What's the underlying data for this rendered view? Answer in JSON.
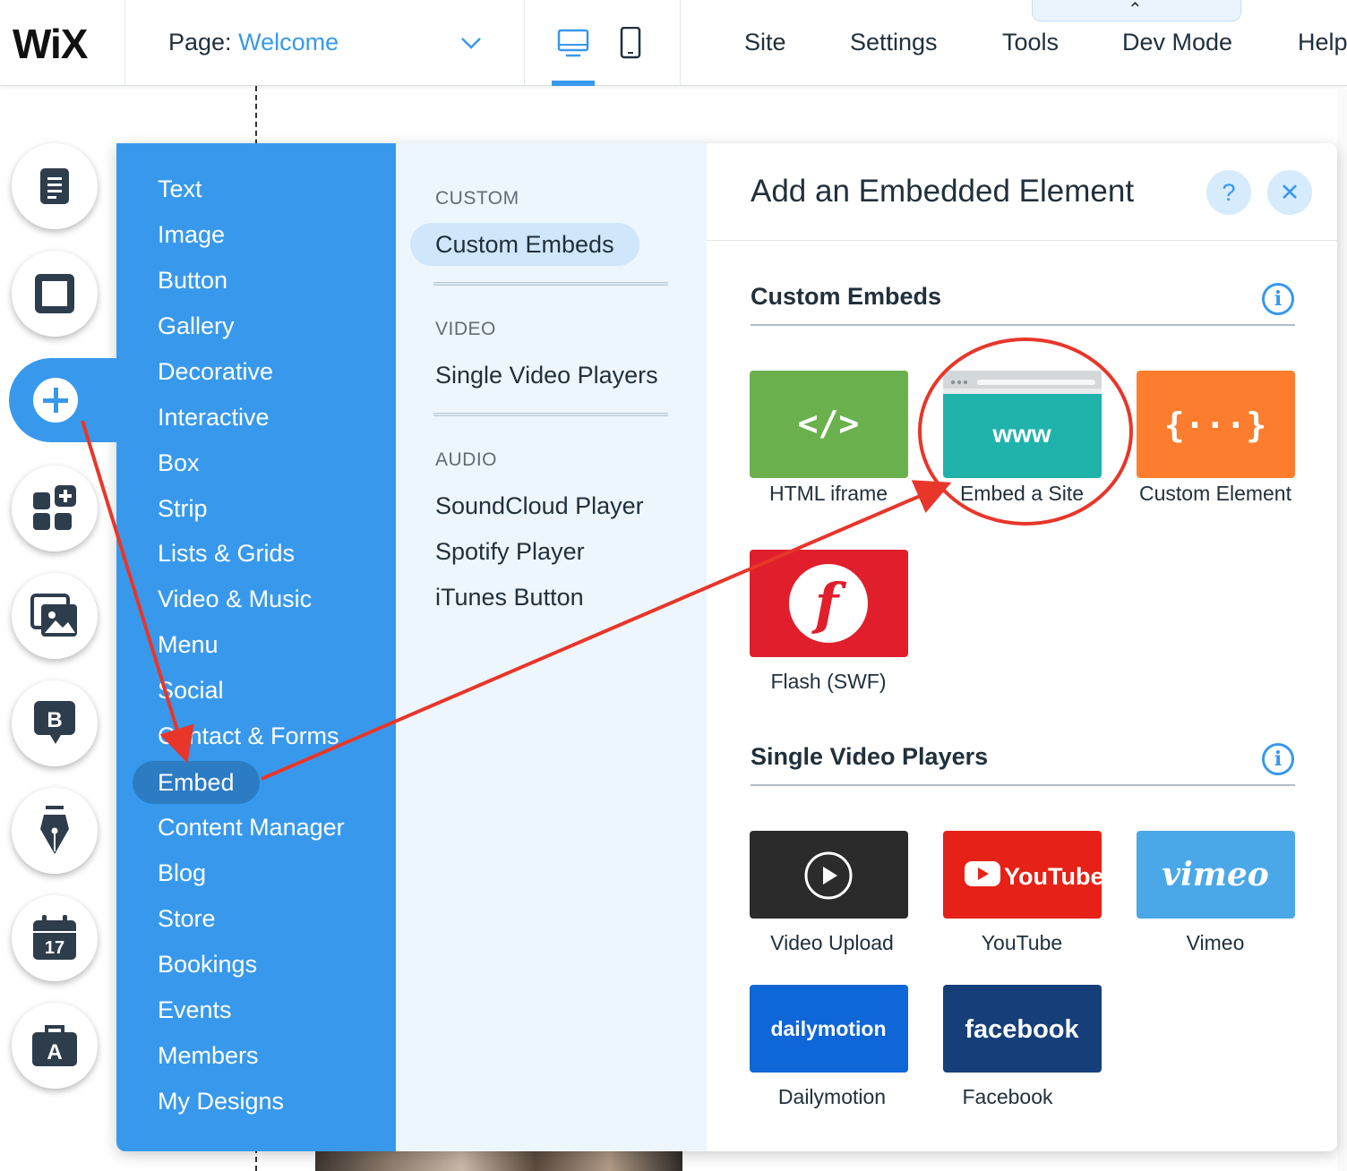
{
  "topbar": {
    "logo": "WiX",
    "page_label": "Page:",
    "page_value": "Welcome",
    "menu": [
      "Site",
      "Settings",
      "Tools",
      "Dev Mode",
      "Help"
    ],
    "collapse_glyph": "⌃"
  },
  "categories": [
    "Text",
    "Image",
    "Button",
    "Gallery",
    "Decorative",
    "Interactive",
    "Box",
    "Strip",
    "Lists & Grids",
    "Video & Music",
    "Menu",
    "Social",
    "Contact & Forms",
    "Embed",
    "Content Manager",
    "Blog",
    "Store",
    "Bookings",
    "Events",
    "Members",
    "My Designs"
  ],
  "active_category": "Embed",
  "subcategories": {
    "custom_head": "CUSTOM",
    "custom_items": [
      "Custom Embeds"
    ],
    "video_head": "VIDEO",
    "video_items": [
      "Single Video Players"
    ],
    "audio_head": "AUDIO",
    "audio_items": [
      "SoundCloud Player",
      "Spotify Player",
      "iTunes Button"
    ]
  },
  "content": {
    "title": "Add an Embedded Element",
    "help_glyph": "?",
    "close_glyph": "✕",
    "info_glyph": "i",
    "sections": [
      {
        "title": "Custom Embeds",
        "items": [
          {
            "label": "HTML iframe",
            "icon": "code-icon",
            "glyph": "</>",
            "color": "#6ab04c"
          },
          {
            "label": "Embed a Site",
            "icon": "browser-www-icon",
            "glyph": "www",
            "color": "#1fb3ac"
          },
          {
            "label": "Custom Element",
            "icon": "braces-icon",
            "glyph": "{···}",
            "color": "#fc7d2e"
          },
          {
            "label": "Flash (SWF)",
            "icon": "flash-icon",
            "glyph": "f",
            "color": "#e11e2c"
          }
        ]
      },
      {
        "title": "Single Video Players",
        "items": [
          {
            "label": "Video Upload",
            "icon": "play-icon",
            "color": "#2b2b2b"
          },
          {
            "label": "YouTube",
            "icon": "youtube-logo-icon",
            "glyph": "YouTube",
            "color": "#e62117"
          },
          {
            "label": "Vimeo",
            "icon": "vimeo-logo-icon",
            "glyph": "vimeo",
            "color": "#4aa8e8"
          },
          {
            "label": "Dailymotion",
            "icon": "dailymotion-logo-icon",
            "glyph": "dailymotion",
            "color": "#0f66d6"
          },
          {
            "label": "Facebook",
            "icon": "facebook-logo-icon",
            "glyph": "facebook",
            "color": "#163f7a"
          }
        ]
      }
    ]
  },
  "colors": {
    "accent": "#3899ec",
    "annotation": "#e8362a"
  }
}
